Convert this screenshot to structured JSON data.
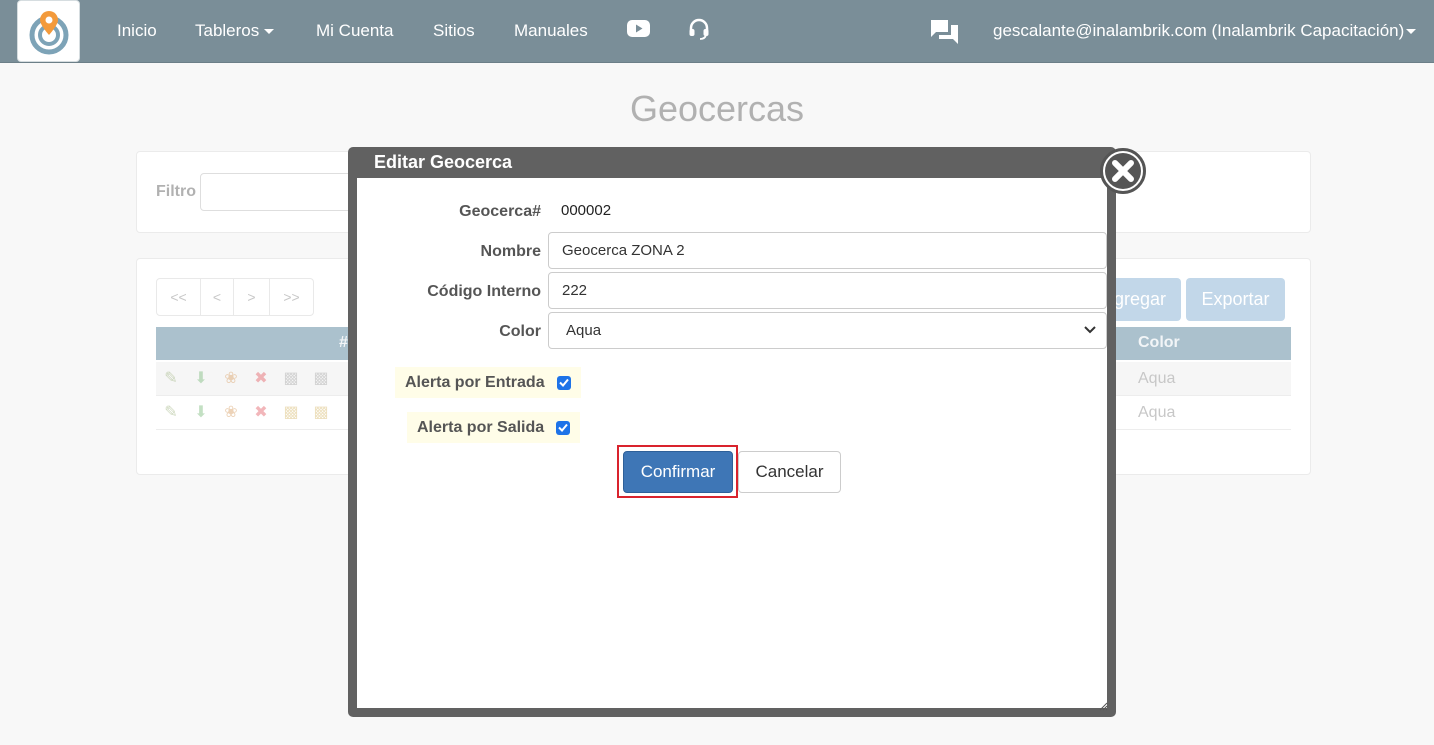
{
  "navbar": {
    "items": [
      {
        "label": "Inicio"
      },
      {
        "label": "Tableros"
      },
      {
        "label": "Mi Cuenta"
      },
      {
        "label": "Sitios"
      },
      {
        "label": "Manuales"
      }
    ],
    "user_label": "gescalante@inalambrik.com (Inalambrik Capacitación)",
    "icons": [
      "logo-icon",
      "youtube-icon",
      "headset-icon",
      "chat-icon"
    ]
  },
  "page": {
    "title": "Geocercas",
    "filter_label": "Filtro",
    "pager": [
      "<<",
      "<",
      ">",
      ">>"
    ],
    "add_button": "gregar",
    "export_button": "Exportar",
    "table": {
      "headers": {
        "id": "#",
        "color": "Color"
      },
      "rows": [
        {
          "color": "Aqua"
        },
        {
          "color": "Aqua"
        }
      ]
    }
  },
  "modal": {
    "title": "Editar Geocerca",
    "geocerca_label": "Geocerca#",
    "geocerca_value": "000002",
    "nombre_label": "Nombre",
    "nombre_value": "Geocerca ZONA 2",
    "codigo_label": "Código Interno",
    "codigo_value": "222",
    "color_label": "Color",
    "color_value": "Aqua",
    "alerta_entrada_label": "Alerta por Entrada",
    "alerta_entrada_checked": true,
    "alerta_salida_label": "Alerta por Salida",
    "alerta_salida_checked": true,
    "confirm_label": "Confirmar",
    "cancel_label": "Cancelar"
  },
  "colors": {
    "navbar": "#7a8e98",
    "primary": "#3e76b6",
    "highlight_outline": "#d9232d",
    "checkbox": "#1e73e8"
  }
}
